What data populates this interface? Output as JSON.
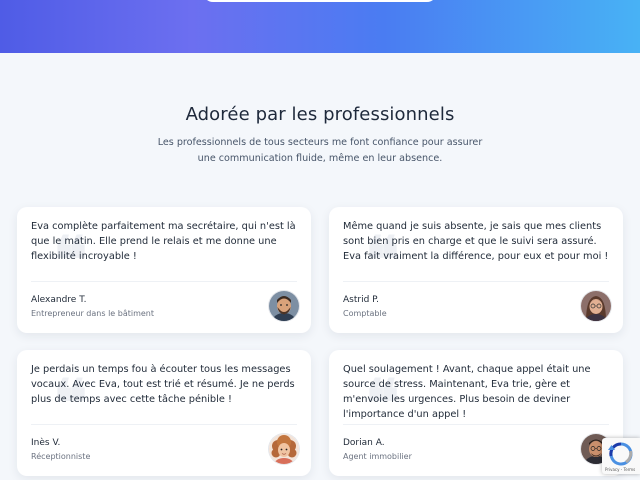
{
  "section": {
    "title": "Adorée par les professionnels",
    "subtitle": "Les professionnels de tous secteurs me font confiance pour assurer une communication fluide, même en leur absence."
  },
  "testimonials": [
    {
      "quote": "Eva complète parfaitement ma secrétaire, qui n'est là que le matin. Elle prend le relais et me donne une flexibilité incroyable !",
      "name": "Alexandre T.",
      "role": "Entrepreneur dans le bâtiment",
      "avatar": "man-with-beard-avatar-icon"
    },
    {
      "quote": "Même quand je suis absente, je sais que mes clients sont bien pris en charge et que le suivi sera assuré. Eva fait vraiment la différence, pour eux et pour moi !",
      "name": "Astrid P.",
      "role": "Comptable",
      "avatar": "woman-with-glasses-avatar-icon"
    },
    {
      "quote": "Je perdais un temps fou à écouter tous les messages vocaux. Avec Eva, tout est trié et résumé. Je ne perds plus de temps avec cette tâche pénible !",
      "name": "Inès V.",
      "role": "Réceptionniste",
      "avatar": "curly-haired-woman-avatar-icon"
    },
    {
      "quote": "Quel soulagement ! Avant, chaque appel était une source de stress. Maintenant, Eva trie, gère et m'envoie les urgences. Plus besoin de deviner l'importance d'un appel !",
      "name": "Dorian A.",
      "role": "Agent immobilier",
      "avatar": "man-with-glasses-avatar-icon"
    }
  ],
  "recaptcha": {
    "links": "Privacy - Terms"
  },
  "colors": {
    "hero_gradient_start": "#4f5ce6",
    "hero_gradient_end": "#48b2f5",
    "page_background": "#f4f7fb",
    "card_background": "#ffffff"
  }
}
